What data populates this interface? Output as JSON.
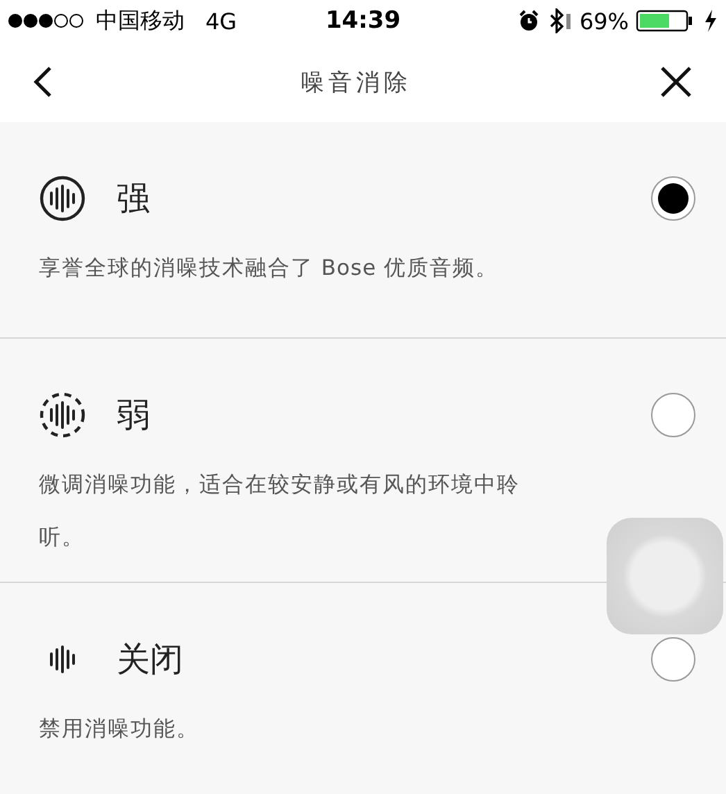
{
  "status_bar": {
    "carrier": "中国移动",
    "network": "4G",
    "time": "14:39",
    "battery_percent": "69%"
  },
  "nav": {
    "title": "噪音消除"
  },
  "options": [
    {
      "kind": "strong",
      "title": "强",
      "description": "享誉全球的消噪技术融合了 Bose 优质音频。",
      "selected": true
    },
    {
      "kind": "weak",
      "title": "弱",
      "description": "微调消噪功能，适合在较安静或有风的环境中聆听。",
      "selected": false
    },
    {
      "kind": "off",
      "title": "关闭",
      "description": "禁用消噪功能。",
      "selected": false
    }
  ]
}
